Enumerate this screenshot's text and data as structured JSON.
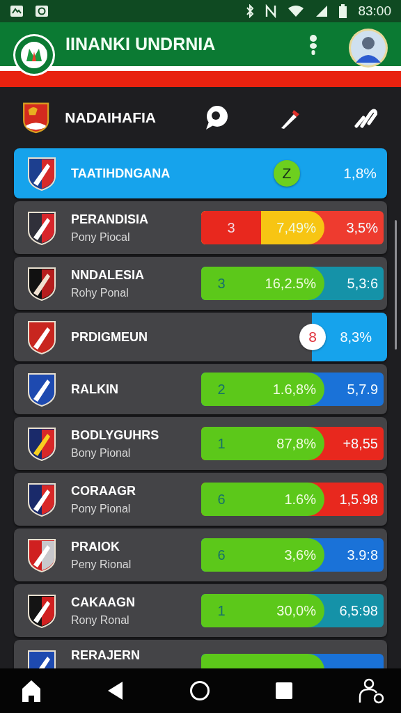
{
  "status_bar": {
    "time": "83:00"
  },
  "header": {
    "title": "IINANKI UNDRNIA"
  },
  "section": {
    "title": "NADAIHAFIA"
  },
  "rows": [
    {
      "kind": "highlight",
      "title": "TAATIHDNGANA",
      "badge": {
        "text": "Z",
        "color": "#6dd01f"
      },
      "value": {
        "text": "1,8%",
        "color": "#16a3ec"
      }
    },
    {
      "kind": "bar",
      "title": "PERANDISIA",
      "subtitle": "Pony Piocal",
      "rank": {
        "text": "3",
        "color": "#e8281e"
      },
      "percent": {
        "text": "7,49%",
        "color": "#f7c513"
      },
      "value": {
        "text": "3,5%",
        "color": "#ee3b2f"
      }
    },
    {
      "kind": "bar",
      "title": "NNDALESIA",
      "subtitle": "Rohy Ponal",
      "rank": {
        "text": "3",
        "color": "#5cc81a"
      },
      "percent": {
        "text": "16,2.5%",
        "color": "#5cc81a"
      },
      "value": {
        "text": "5,3:6",
        "color": "#1592a8"
      }
    },
    {
      "kind": "badge",
      "title": "PRDIGMEUN",
      "badge": {
        "text": "8",
        "color": "#ffffff"
      },
      "value": {
        "text": "8,3%",
        "color": "#16a3ec"
      }
    },
    {
      "kind": "bar",
      "title": "RALKIN",
      "rank": {
        "text": "2",
        "color": "#5cc81a"
      },
      "percent": {
        "text": "1.6,8%",
        "color": "#5cc81a"
      },
      "value": {
        "text": "5,7.9",
        "color": "#1a72d8"
      }
    },
    {
      "kind": "bar",
      "title": "BODLYGUHRS",
      "subtitle": "Bony Pional",
      "rank": {
        "text": "1",
        "color": "#5cc81a"
      },
      "percent": {
        "text": "87,8%",
        "color": "#5cc81a"
      },
      "value": {
        "text": "+8,55",
        "color": "#e8281e"
      }
    },
    {
      "kind": "bar",
      "title": "CORAAGR",
      "subtitle": "Pony Pional",
      "rank": {
        "text": "6",
        "color": "#5cc81a"
      },
      "percent": {
        "text": "1.6%",
        "color": "#5cc81a"
      },
      "value": {
        "text": "1,5.98",
        "color": "#e8281e"
      }
    },
    {
      "kind": "bar",
      "title": "PRAIOK",
      "subtitle": "Peny Rional",
      "rank": {
        "text": "6",
        "color": "#5cc81a"
      },
      "percent": {
        "text": "3,6%",
        "color": "#5cc81a"
      },
      "value": {
        "text": "3.9:8",
        "color": "#1a72d8"
      }
    },
    {
      "kind": "bar",
      "title": "CAKAAGN",
      "subtitle": "Rony Ronal",
      "rank": {
        "text": "1",
        "color": "#5cc81a"
      },
      "percent": {
        "text": "30,0%",
        "color": "#5cc81a"
      },
      "value": {
        "text": "6,5:98",
        "color": "#1592a8"
      }
    },
    {
      "kind": "partial",
      "title": "RERAJERN",
      "percent": {
        "color": "#5cc81a"
      },
      "value": {
        "color": "#1a72d8"
      }
    }
  ]
}
